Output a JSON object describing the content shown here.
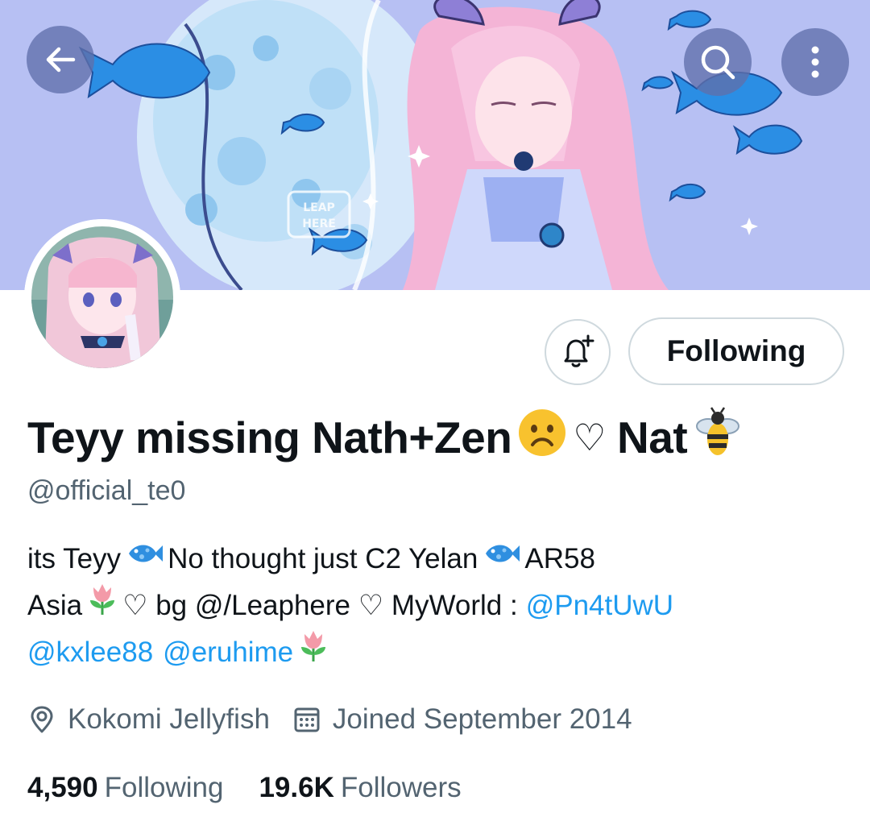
{
  "header": {
    "back_icon": "arrow-left-icon",
    "search_icon": "search-icon",
    "more_icon": "more-vertical-icon"
  },
  "banner": {
    "watermark_text": "LEAP HERE"
  },
  "profile": {
    "display_name_part1": "Teyy missing Nath+Zen",
    "display_name_heart": "♡",
    "display_name_part2": "Nat",
    "handle": "@official_te0",
    "bio": {
      "line1_a": "its Teyy",
      "line1_b": "No thought just C2 Yelan",
      "line1_c": "AR58",
      "line2_a": "Asia",
      "line2_b": "♡ bg @/Leaphere ♡ MyWorld :",
      "line2_mention": "@Pn4tUwU",
      "line3_mention1": "@kxlee88",
      "line3_mention2": "@eruhime"
    },
    "location": "Kokomi Jellyfish",
    "joined": "Joined September 2014",
    "following_count": "4,590",
    "following_label": "Following",
    "followers_count": "19.6K",
    "followers_label": "Followers"
  },
  "actions": {
    "notify_icon": "bell-plus-icon",
    "following_button": "Following"
  },
  "colors": {
    "link": "#1d9bf0",
    "secondary_text": "#536471",
    "primary_text": "#0f1419",
    "border": "#cfd9de",
    "banner_bg": "#b9c2f4"
  }
}
